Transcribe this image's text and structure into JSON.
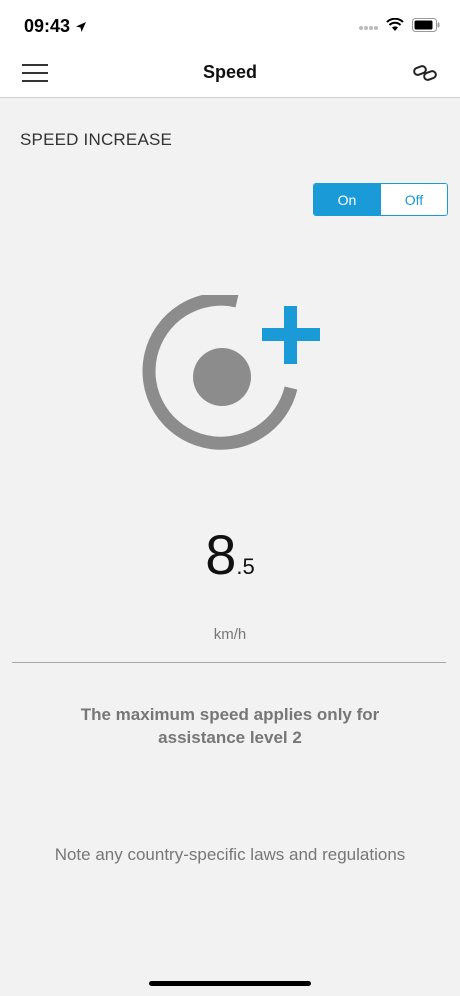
{
  "status_bar": {
    "time": "09:43",
    "location_icon": "location-arrow-icon",
    "signal_icon": "cellular-signal-icon",
    "wifi_icon": "wifi-icon",
    "battery_icon": "battery-icon"
  },
  "nav": {
    "title": "Speed",
    "menu_icon": "hamburger-menu-icon",
    "link_icon": "link-icon"
  },
  "section": {
    "title": "SPEED INCREASE"
  },
  "toggle": {
    "on_label": "On",
    "off_label": "Off",
    "selected": "On"
  },
  "speed": {
    "integer": "8",
    "decimal": ".5",
    "unit": "km/h"
  },
  "notes": {
    "assistance": "The maximum speed applies only for assistance level 2",
    "laws": "Note any country-specific laws and regulations"
  },
  "colors": {
    "accent": "#1a9ad7",
    "graphic_gray": "#8c8c8c",
    "background": "#f2f2f2"
  }
}
